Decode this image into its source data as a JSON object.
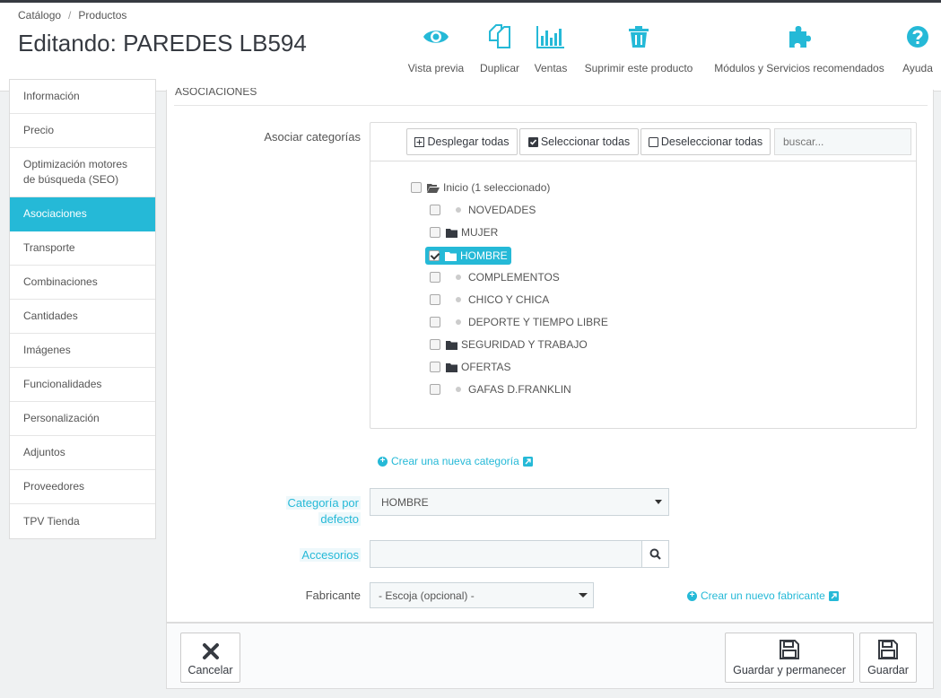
{
  "breadcrumb": {
    "items": [
      "Catálogo",
      "Productos"
    ],
    "separator": "/"
  },
  "title": "Editando: PAREDES LB594",
  "toolbar": {
    "preview": "Vista previa",
    "duplicate": "Duplicar",
    "sales": "Ventas",
    "delete": "Suprimir este producto",
    "modules": "Módulos y Servicios recomendados",
    "help": "Ayuda"
  },
  "sidebar": {
    "items": [
      "Información",
      "Precio",
      "Optimización motores de búsqueda (SEO)",
      "Asociaciones",
      "Transporte",
      "Combinaciones",
      "Cantidades",
      "Imágenes",
      "Funcionalidades",
      "Personalización",
      "Adjuntos",
      "Proveedores",
      "TPV Tienda"
    ],
    "active_index": 3
  },
  "panel": {
    "heading": "ASOCIACIONES",
    "assoc_label": "Asociar categorías",
    "tree_buttons": {
      "expand": "Desplegar todas",
      "select": "Seleccionar todas",
      "deselect": "Deseleccionar todas"
    },
    "search_placeholder": "buscar...",
    "tree": {
      "root": "Inicio (1 seleccionado)",
      "children": [
        {
          "label": "NOVEDADES",
          "type": "leaf",
          "checked": false
        },
        {
          "label": "MUJER",
          "type": "folder",
          "checked": false
        },
        {
          "label": "HOMBRE",
          "type": "folder",
          "checked": true
        },
        {
          "label": "COMPLEMENTOS",
          "type": "leaf",
          "checked": false
        },
        {
          "label": "CHICO Y CHICA",
          "type": "leaf",
          "checked": false
        },
        {
          "label": "DEPORTE Y TIEMPO LIBRE",
          "type": "leaf",
          "checked": false
        },
        {
          "label": "SEGURIDAD Y TRABAJO",
          "type": "folder",
          "checked": false
        },
        {
          "label": "OFERTAS",
          "type": "folder",
          "checked": false
        },
        {
          "label": "GAFAS D.FRANKLIN",
          "type": "leaf",
          "checked": false
        }
      ]
    },
    "create_category": "Crear una nueva categoría",
    "default_category_label_1": "Categoría por",
    "default_category_label_2": "defecto",
    "default_category_value": "HOMBRE",
    "accessories_label": "Accesorios",
    "manufacturer_label": "Fabricante",
    "manufacturer_value": "- Escoja (opcional) -",
    "create_manufacturer": "Crear un nuevo fabricante"
  },
  "footer": {
    "cancel": "Cancelar",
    "save_stay": "Guardar y permanecer",
    "save": "Guardar"
  },
  "colors": {
    "accent": "#25b9d7",
    "dark": "#363a41"
  }
}
